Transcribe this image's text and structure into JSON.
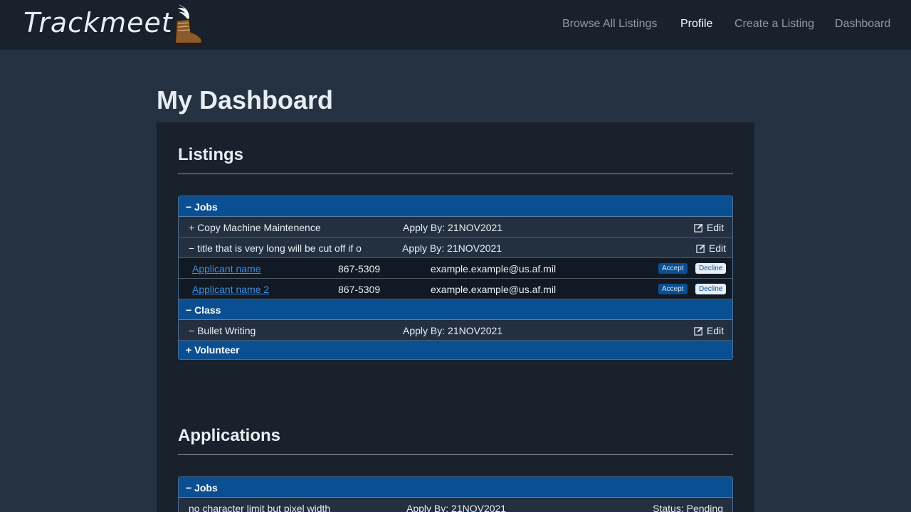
{
  "brand": {
    "name": "Trackmeet",
    "logo_icon": "winged-boot-icon"
  },
  "nav": {
    "links": [
      "Browse All Listings",
      "Profile",
      "Create a Listing",
      "Dashboard"
    ],
    "active": "Profile"
  },
  "page_title": "My Dashboard",
  "listings": {
    "title": "Listings",
    "categories": {
      "jobs": {
        "label": "− Jobs"
      },
      "class": {
        "label": "− Class"
      },
      "volunteer": {
        "label": "+ Volunteer"
      }
    },
    "items": [
      {
        "title": "+ Copy Machine Maintenence",
        "apply_by": "Apply By: 21NOV2021",
        "edit": "Edit"
      },
      {
        "title": "− title that is very long will be cut off if o",
        "apply_by": "Apply By: 21NOV2021",
        "edit": "Edit"
      },
      {
        "title": "− Bullet Writing",
        "apply_by": "Apply By: 21NOV2021",
        "edit": "Edit"
      }
    ],
    "applicants": [
      {
        "name": "Applicant name",
        "phone": "867-5309",
        "email": "example.example@us.af.mil",
        "accept": "Accept",
        "decline": "Decline"
      },
      {
        "name": "Applicant name 2",
        "phone": "867-5309",
        "email": "example.example@us.af.mil",
        "accept": "Accept",
        "decline": "Decline"
      }
    ]
  },
  "applications": {
    "title": "Applications",
    "categories": {
      "jobs": {
        "label": "− Jobs"
      }
    },
    "items": [
      {
        "title": "no character limit but pixel width",
        "apply_by": "Apply By: 21NOV2021",
        "status": "Status: Pending"
      }
    ]
  },
  "colors": {
    "navbar": "#18212c",
    "page_bg": "#243241",
    "panel": "#18212c",
    "category_bar": "#0b4f93",
    "link": "#3b8fe6"
  }
}
